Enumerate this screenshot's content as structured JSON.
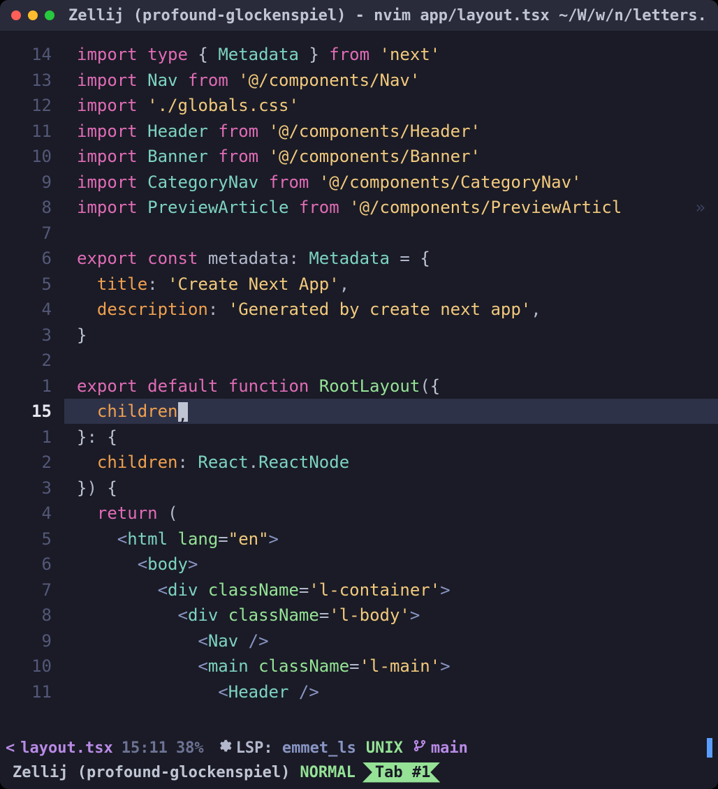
{
  "window": {
    "title": "Zellij (profound-glockenspiel) - nvim app/layout.tsx ~/W/w/n/letters..."
  },
  "code": {
    "lines": [
      {
        "n": "14",
        "segs": [
          {
            "c": "kw-import",
            "t": "import"
          },
          {
            "c": "",
            "t": " "
          },
          {
            "c": "kw-type",
            "t": "type"
          },
          {
            "c": "",
            "t": " "
          },
          {
            "c": "brace",
            "t": "{ "
          },
          {
            "c": "ident",
            "t": "Metadata"
          },
          {
            "c": "brace",
            "t": " }"
          },
          {
            "c": "",
            "t": " "
          },
          {
            "c": "kw-from",
            "t": "from"
          },
          {
            "c": "",
            "t": " "
          },
          {
            "c": "string",
            "t": "'next'"
          }
        ]
      },
      {
        "n": "13",
        "segs": [
          {
            "c": "kw-import",
            "t": "import"
          },
          {
            "c": "",
            "t": " "
          },
          {
            "c": "ident",
            "t": "Nav"
          },
          {
            "c": "",
            "t": " "
          },
          {
            "c": "kw-from",
            "t": "from"
          },
          {
            "c": "",
            "t": " "
          },
          {
            "c": "string",
            "t": "'@/components/Nav'"
          }
        ]
      },
      {
        "n": "12",
        "segs": [
          {
            "c": "kw-import",
            "t": "import"
          },
          {
            "c": "",
            "t": " "
          },
          {
            "c": "string",
            "t": "'./globals.css'"
          }
        ]
      },
      {
        "n": "11",
        "segs": [
          {
            "c": "kw-import",
            "t": "import"
          },
          {
            "c": "",
            "t": " "
          },
          {
            "c": "ident",
            "t": "Header"
          },
          {
            "c": "",
            "t": " "
          },
          {
            "c": "kw-from",
            "t": "from"
          },
          {
            "c": "",
            "t": " "
          },
          {
            "c": "string",
            "t": "'@/components/Header'"
          }
        ]
      },
      {
        "n": "10",
        "segs": [
          {
            "c": "kw-import",
            "t": "import"
          },
          {
            "c": "",
            "t": " "
          },
          {
            "c": "ident",
            "t": "Banner"
          },
          {
            "c": "",
            "t": " "
          },
          {
            "c": "kw-from",
            "t": "from"
          },
          {
            "c": "",
            "t": " "
          },
          {
            "c": "string",
            "t": "'@/components/Banner'"
          }
        ]
      },
      {
        "n": "9",
        "segs": [
          {
            "c": "kw-import",
            "t": "import"
          },
          {
            "c": "",
            "t": " "
          },
          {
            "c": "ident",
            "t": "CategoryNav"
          },
          {
            "c": "",
            "t": " "
          },
          {
            "c": "kw-from",
            "t": "from"
          },
          {
            "c": "",
            "t": " "
          },
          {
            "c": "string",
            "t": "'@/components/CategoryNav'"
          }
        ]
      },
      {
        "n": "8",
        "segs": [
          {
            "c": "kw-import",
            "t": "import"
          },
          {
            "c": "",
            "t": " "
          },
          {
            "c": "ident",
            "t": "PreviewArticle"
          },
          {
            "c": "",
            "t": " "
          },
          {
            "c": "kw-from",
            "t": "from"
          },
          {
            "c": "",
            "t": " "
          },
          {
            "c": "string",
            "t": "'@/components/PreviewArticl"
          }
        ],
        "overflow": "»"
      },
      {
        "n": "7",
        "segs": []
      },
      {
        "n": "6",
        "segs": [
          {
            "c": "kw-export",
            "t": "export"
          },
          {
            "c": "",
            "t": " "
          },
          {
            "c": "kw-const",
            "t": "const"
          },
          {
            "c": "",
            "t": " "
          },
          {
            "c": "punct",
            "t": "metadata"
          },
          {
            "c": "punct",
            "t": ": "
          },
          {
            "c": "typename",
            "t": "Metadata"
          },
          {
            "c": "",
            "t": " "
          },
          {
            "c": "punct",
            "t": "= "
          },
          {
            "c": "brace",
            "t": "{"
          }
        ]
      },
      {
        "n": "5",
        "segs": [
          {
            "c": "",
            "t": "  "
          },
          {
            "c": "prop",
            "t": "title"
          },
          {
            "c": "punct",
            "t": ": "
          },
          {
            "c": "string",
            "t": "'Create Next App'"
          },
          {
            "c": "punct",
            "t": ","
          }
        ]
      },
      {
        "n": "4",
        "segs": [
          {
            "c": "",
            "t": "  "
          },
          {
            "c": "prop",
            "t": "description"
          },
          {
            "c": "punct",
            "t": ": "
          },
          {
            "c": "string",
            "t": "'Generated by create next app'"
          },
          {
            "c": "punct",
            "t": ","
          }
        ]
      },
      {
        "n": "3",
        "segs": [
          {
            "c": "brace",
            "t": "}"
          }
        ]
      },
      {
        "n": "2",
        "segs": []
      },
      {
        "n": "1",
        "segs": [
          {
            "c": "kw-export",
            "t": "export"
          },
          {
            "c": "",
            "t": " "
          },
          {
            "c": "kw-default",
            "t": "default"
          },
          {
            "c": "",
            "t": " "
          },
          {
            "c": "kw-function",
            "t": "function"
          },
          {
            "c": "",
            "t": " "
          },
          {
            "c": "funcname",
            "t": "RootLayout"
          },
          {
            "c": "punct",
            "t": "("
          },
          {
            "c": "brace",
            "t": "{"
          }
        ]
      },
      {
        "n": "15",
        "cursor": true,
        "segs": [
          {
            "c": "",
            "t": "  "
          },
          {
            "c": "prop",
            "t": "children"
          },
          {
            "c": "cursor-block",
            "t": ","
          }
        ]
      },
      {
        "n": "1",
        "segs": [
          {
            "c": "brace",
            "t": "}"
          },
          {
            "c": "punct",
            "t": ": "
          },
          {
            "c": "brace",
            "t": "{"
          }
        ]
      },
      {
        "n": "2",
        "segs": [
          {
            "c": "",
            "t": "  "
          },
          {
            "c": "prop",
            "t": "children"
          },
          {
            "c": "punct",
            "t": ": "
          },
          {
            "c": "typename",
            "t": "React"
          },
          {
            "c": "punct",
            "t": "."
          },
          {
            "c": "typename",
            "t": "ReactNode"
          }
        ]
      },
      {
        "n": "3",
        "segs": [
          {
            "c": "brace",
            "t": "}"
          },
          {
            "c": "punct",
            "t": ") "
          },
          {
            "c": "brace",
            "t": "{"
          }
        ]
      },
      {
        "n": "4",
        "segs": [
          {
            "c": "",
            "t": "  "
          },
          {
            "c": "kw-return",
            "t": "return"
          },
          {
            "c": "",
            "t": " "
          },
          {
            "c": "punct",
            "t": "("
          }
        ]
      },
      {
        "n": "5",
        "segs": [
          {
            "c": "",
            "t": "    "
          },
          {
            "c": "angle",
            "t": "<"
          },
          {
            "c": "tag",
            "t": "html"
          },
          {
            "c": "",
            "t": " "
          },
          {
            "c": "attr",
            "t": "lang"
          },
          {
            "c": "punct",
            "t": "="
          },
          {
            "c": "string",
            "t": "\"en\""
          },
          {
            "c": "angle",
            "t": ">"
          }
        ]
      },
      {
        "n": "6",
        "segs": [
          {
            "c": "",
            "t": "      "
          },
          {
            "c": "angle",
            "t": "<"
          },
          {
            "c": "tag",
            "t": "body"
          },
          {
            "c": "angle",
            "t": ">"
          }
        ]
      },
      {
        "n": "7",
        "segs": [
          {
            "c": "",
            "t": "        "
          },
          {
            "c": "angle",
            "t": "<"
          },
          {
            "c": "tag",
            "t": "div"
          },
          {
            "c": "",
            "t": " "
          },
          {
            "c": "attr",
            "t": "className"
          },
          {
            "c": "punct",
            "t": "="
          },
          {
            "c": "string",
            "t": "'l-container'"
          },
          {
            "c": "angle",
            "t": ">"
          }
        ]
      },
      {
        "n": "8",
        "segs": [
          {
            "c": "",
            "t": "          "
          },
          {
            "c": "angle",
            "t": "<"
          },
          {
            "c": "tag",
            "t": "div"
          },
          {
            "c": "",
            "t": " "
          },
          {
            "c": "attr",
            "t": "className"
          },
          {
            "c": "punct",
            "t": "="
          },
          {
            "c": "string",
            "t": "'l-body'"
          },
          {
            "c": "angle",
            "t": ">"
          }
        ]
      },
      {
        "n": "9",
        "segs": [
          {
            "c": "",
            "t": "            "
          },
          {
            "c": "angle",
            "t": "<"
          },
          {
            "c": "tag",
            "t": "Nav"
          },
          {
            "c": "",
            "t": " "
          },
          {
            "c": "angle",
            "t": "/>"
          }
        ]
      },
      {
        "n": "10",
        "segs": [
          {
            "c": "",
            "t": "            "
          },
          {
            "c": "angle",
            "t": "<"
          },
          {
            "c": "tag",
            "t": "main"
          },
          {
            "c": "",
            "t": " "
          },
          {
            "c": "attr",
            "t": "className"
          },
          {
            "c": "punct",
            "t": "="
          },
          {
            "c": "string",
            "t": "'l-main'"
          },
          {
            "c": "angle",
            "t": ">"
          }
        ]
      },
      {
        "n": "11",
        "segs": [
          {
            "c": "",
            "t": "              "
          },
          {
            "c": "angle",
            "t": "<"
          },
          {
            "c": "tag",
            "t": "Header"
          },
          {
            "c": "",
            "t": " "
          },
          {
            "c": "angle",
            "t": "/>"
          }
        ]
      }
    ]
  },
  "statusline": {
    "caret": "<",
    "filename": "layout.tsx",
    "position": "15:11",
    "percent": "38%",
    "lsp_label": "LSP:",
    "lsp_value": "emmet_ls",
    "encoding": "UNIX",
    "branch": "main"
  },
  "zellij": {
    "session": "Zellij (profound-glockenspiel)",
    "mode": "NORMAL",
    "tab": "Tab #1"
  }
}
